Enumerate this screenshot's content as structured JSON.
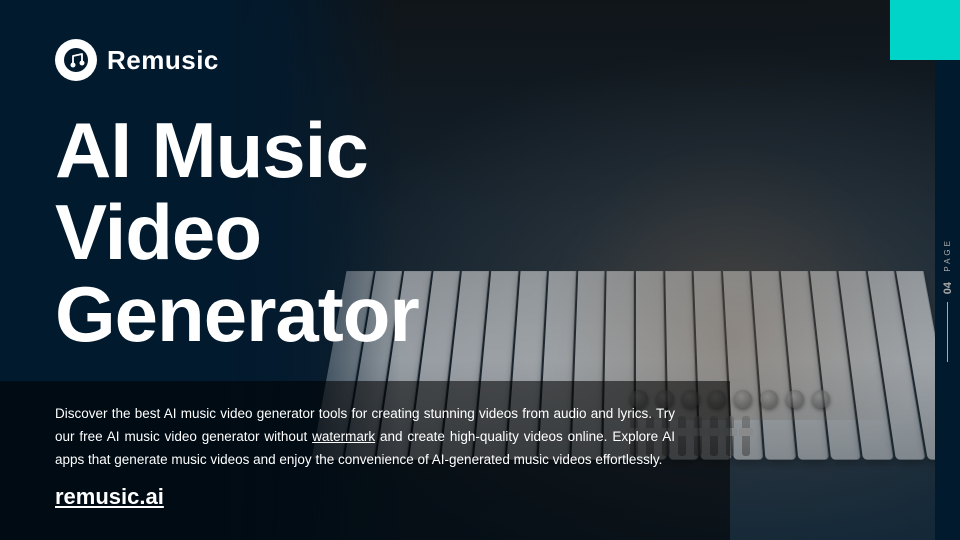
{
  "page": {
    "background_color": "#021a2e",
    "teal_accent_color": "#00d4c8"
  },
  "header": {
    "logo_text": "Remusic",
    "logo_icon_name": "music-note-icon"
  },
  "hero": {
    "title_line1": "AI Music Video",
    "title_line2": "Generator"
  },
  "description": {
    "body": "Discover the best AI music video generator tools for creating stunning videos from audio and lyrics. Try our free AI music video generator without watermark and create high-quality videos online. Explore AI apps that generate music videos and enjoy the convenience of AI-generated music videos effortlessly.",
    "site_link": "remusic.ai"
  },
  "page_indicator": {
    "page_label": "PAGE",
    "page_number": "04"
  }
}
